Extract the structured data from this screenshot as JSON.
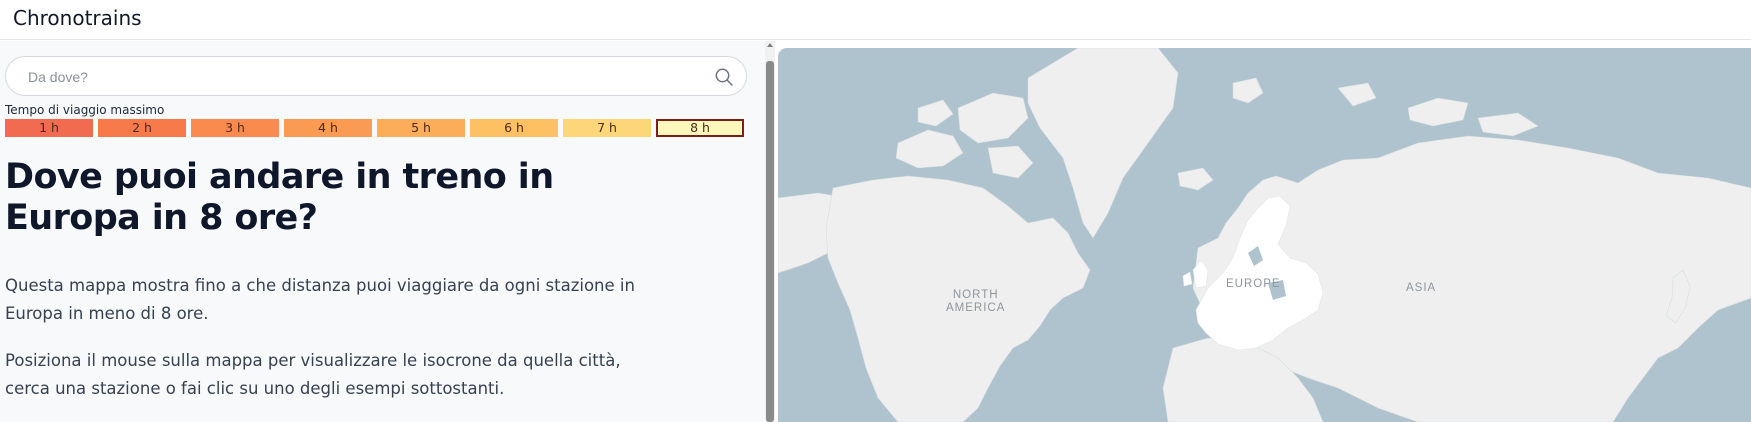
{
  "app": {
    "title": "Chronotrains"
  },
  "search": {
    "placeholder": "Da dove?",
    "value": ""
  },
  "travel_time": {
    "label": "Tempo di viaggio massimo",
    "selected": "8 h",
    "buckets": [
      {
        "label": "1 h",
        "color": "#f26b50"
      },
      {
        "label": "2 h",
        "color": "#f77a4a"
      },
      {
        "label": "3 h",
        "color": "#fa8a4e"
      },
      {
        "label": "4 h",
        "color": "#fb9a52"
      },
      {
        "label": "5 h",
        "color": "#fcad5a"
      },
      {
        "label": "6 h",
        "color": "#fdc164"
      },
      {
        "label": "7 h",
        "color": "#fdd67a"
      },
      {
        "label": "8 h",
        "color": "#fff7bb"
      }
    ]
  },
  "main": {
    "headline": "Dove puoi andare in treno in Europa in 8 ore?",
    "paragraph1": "Questa mappa mostra fino a che distanza puoi viaggiare da ogni stazione in Europa in meno di 8 ore.",
    "paragraph2": "Posiziona il mouse sulla mappa per visualizzare le isocrone da quella città, cerca una stazione o fai clic su uno degli esempi sottostanti."
  },
  "map": {
    "labels": {
      "north_america": "NORTH\nAMERICA",
      "europe": "EUROPE",
      "asia": "ASIA"
    },
    "colors": {
      "water": "#aec3cd",
      "land": "#efefef",
      "europe_highlight": "#ffffff"
    }
  }
}
